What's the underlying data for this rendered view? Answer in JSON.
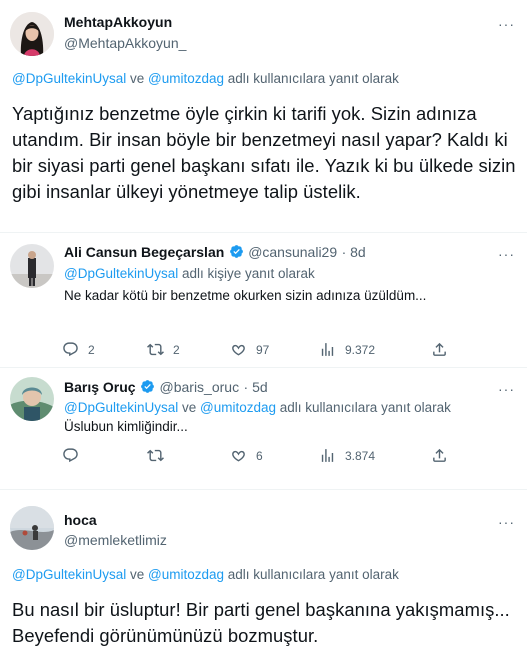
{
  "tweets": [
    {
      "name": "MehtapAkkoyun",
      "handle": "@MehtapAkkoyun_",
      "reply_to": {
        "user1": "@DpGultekinUysal",
        "conj": " ve ",
        "user2": "@umitozdag",
        "suffix": " adlı kullanıcılara yanıt olarak"
      },
      "text": "Yaptığınız benzetme öyle çirkin ki tarifi yok. Sizin adınıza utandım. Bir insan böyle bir benzetmeyi nasıl yapar? Kaldı ki bir siyasi parti genel başkanı sıfatı ile. Yazık ki bu ülkede sizin gibi insanlar ülkeyi yönetmeye talip üstelik."
    },
    {
      "name": "Ali Cansun Begeçarslan",
      "handle": "@cansunali29",
      "time": "· 8d",
      "reply_to": {
        "user1": "@DpGultekinUysal",
        "suffix": " adlı kişiye yanıt olarak"
      },
      "text": "Ne kadar kötü bir benzetme okurken sizin adınıza üzüldüm...",
      "stats": {
        "replies": "2",
        "retweets": "2",
        "likes": "97",
        "views": "9.372"
      }
    },
    {
      "name": "Barış Oruç",
      "handle": "@baris_oruc",
      "time": "· 5d",
      "reply_to": {
        "user1": "@DpGultekinUysal",
        "conj": " ve ",
        "user2": "@umitozdag",
        "suffix": " adlı kullanıcılara yanıt olarak"
      },
      "text": "Üslubun kimliğindir...",
      "stats": {
        "replies": "",
        "retweets": "",
        "likes": "6",
        "views": "3.874"
      }
    },
    {
      "name": "hoca",
      "handle": "@memleketlimiz",
      "reply_to": {
        "user1": "@DpGultekinUysal",
        "conj": " ve ",
        "user2": "@umitozdag",
        "suffix": " adlı kullanıcılara yanıt olarak"
      },
      "text": "Bu nasıl bir üsluptur! Bir parti genel başkanına yakışmamış... Beyefendi görünümünüzü bozmuştur."
    }
  ],
  "more_label": "···",
  "colors": {
    "link": "#1d9bf0",
    "verified": "#1d9bf0",
    "secondary": "#536471",
    "divider": "#eff3f4"
  },
  "icons": [
    "reply-icon",
    "retweet-icon",
    "like-icon",
    "views-icon",
    "share-icon",
    "verified-badge-icon",
    "more-icon"
  ]
}
